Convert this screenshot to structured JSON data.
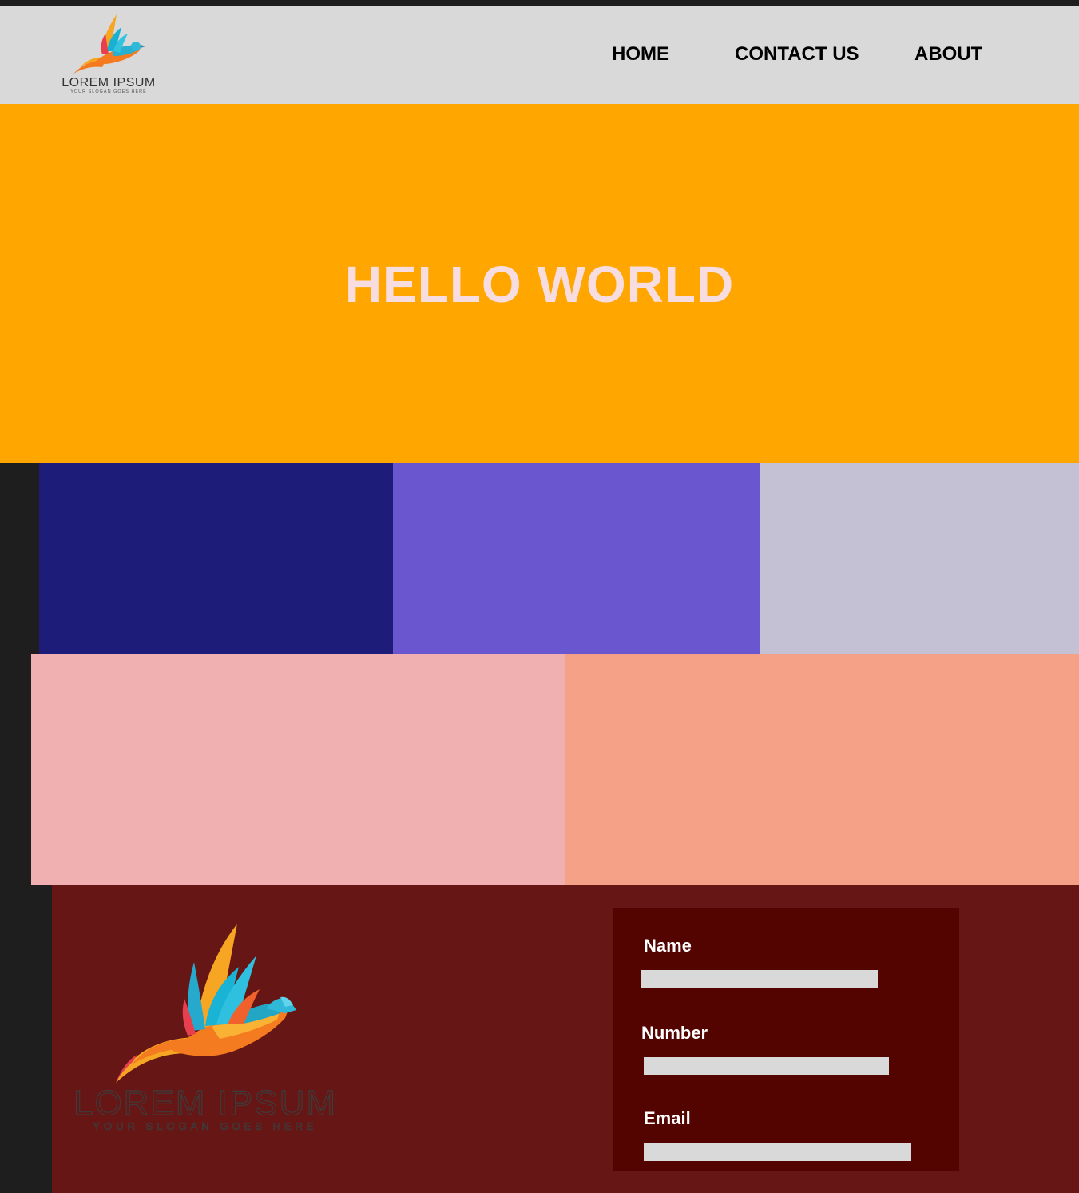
{
  "header": {
    "logo": {
      "icon": "bird-icon",
      "brand": "LOREM IPSUM",
      "slogan": "YOUR SLOGAN GOES HERE"
    },
    "nav": [
      {
        "label": "HOME"
      },
      {
        "label": "CONTACT US"
      },
      {
        "label": "ABOUT"
      }
    ]
  },
  "hero": {
    "title": "HELLO WORLD",
    "background": "#ffa600",
    "title_color": "#f8dde0"
  },
  "tiles": {
    "row1": [
      "#1d1c79",
      "#6a56ce",
      "#c4c1d5"
    ],
    "row2": [
      "#f0b0b1",
      "#f5a187"
    ]
  },
  "footer": {
    "background": "#661614",
    "logo": {
      "icon": "bird-icon",
      "brand": "LOREM IPSUM",
      "slogan": "YOUR SLOGAN GOES HERE"
    },
    "form": {
      "background": "#540400",
      "fields": [
        {
          "label": "Name",
          "value": ""
        },
        {
          "label": "Number",
          "value": ""
        },
        {
          "label": "Email",
          "value": ""
        }
      ]
    }
  }
}
